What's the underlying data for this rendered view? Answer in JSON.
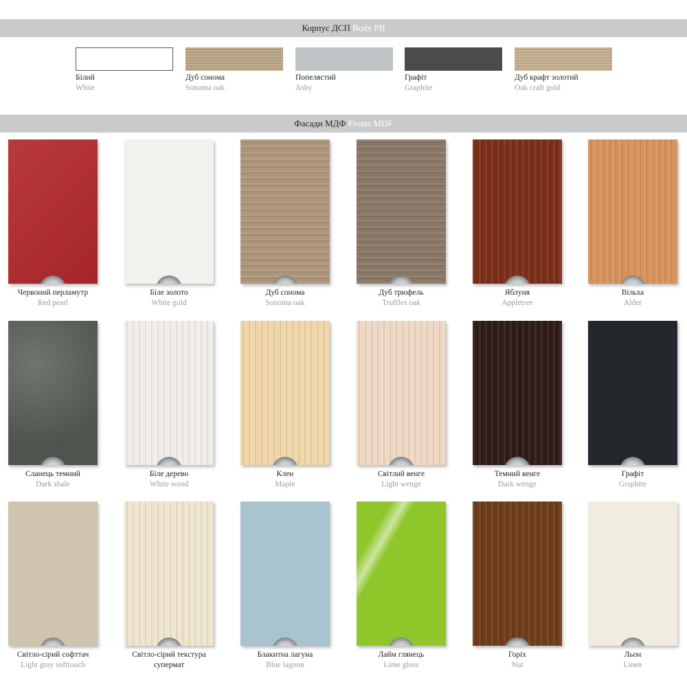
{
  "body_section": {
    "title_ua": "Корпус ДСП",
    "title_en": "Body PB",
    "swatches": [
      {
        "ua": "Білий",
        "en": "White",
        "color": "#ffffff"
      },
      {
        "ua": "Дуб сонома",
        "en": "Sonoma oak",
        "color": "#b9a383"
      },
      {
        "ua": "Попелястий",
        "en": "Ashy",
        "color": "#bfc5c6"
      },
      {
        "ua": "Графіт",
        "en": "Graphite",
        "color": "#4b4b4d"
      },
      {
        "ua": "Дуб крафт золотий",
        "en": "Oak craft gold",
        "color": "#c3ae8c"
      }
    ]
  },
  "fronts_section": {
    "title_ua": "Фасади МДФ",
    "title_en": "Fronts MDF",
    "rows": [
      [
        {
          "ua": "Червоний перламутр",
          "en": "Red pearl",
          "color": "#b3292c"
        },
        {
          "ua": "Біле золото",
          "en": "White gold",
          "color": "#f3f1ed"
        },
        {
          "ua": "Дуб сонома",
          "en": "Sonoma oak",
          "color": "#ad967a"
        },
        {
          "ua": "Дуб трюфель",
          "en": "Truffles oak",
          "color": "#8a7766"
        },
        {
          "ua": "Яблуня",
          "en": "Appletree",
          "color": "#7a2e19"
        },
        {
          "ua": "Вільха",
          "en": "Alder",
          "color": "#d6925a"
        }
      ],
      [
        {
          "ua": "Сланець темний",
          "en": "Dark shale",
          "color": "#5d625c"
        },
        {
          "ua": "Біле дерево",
          "en": "White wood",
          "color": "#f1eeea"
        },
        {
          "ua": "Клен",
          "en": "Maple",
          "color": "#f0d6a8"
        },
        {
          "ua": "Світлий венге",
          "en": "Light wenge",
          "color": "#efd8c4"
        },
        {
          "ua": "Темний венге",
          "en": "Dark wenge",
          "color": "#2f1c17"
        },
        {
          "ua": "Графіт",
          "en": "Graphite",
          "color": "#24282d"
        }
      ],
      [
        {
          "ua": "Світло-сірий софттач",
          "en": "Light gray softtouch",
          "color": "#cfc5ae"
        },
        {
          "ua": "Світло-сірий текстура",
          "en": "супермат",
          "color": "#eee5cc"
        },
        {
          "ua": "Блакитна лагуна",
          "en": "Blue lagoon",
          "color": "#a8c4cf"
        },
        {
          "ua": "Лайм глянець",
          "en": "Lime gloss",
          "color": "#8fc62a"
        },
        {
          "ua": "Горіх",
          "en": "Nut",
          "color": "#6e3c1a"
        },
        {
          "ua": "Льон",
          "en": "Linen",
          "color": "#f1ece0"
        }
      ]
    ]
  }
}
